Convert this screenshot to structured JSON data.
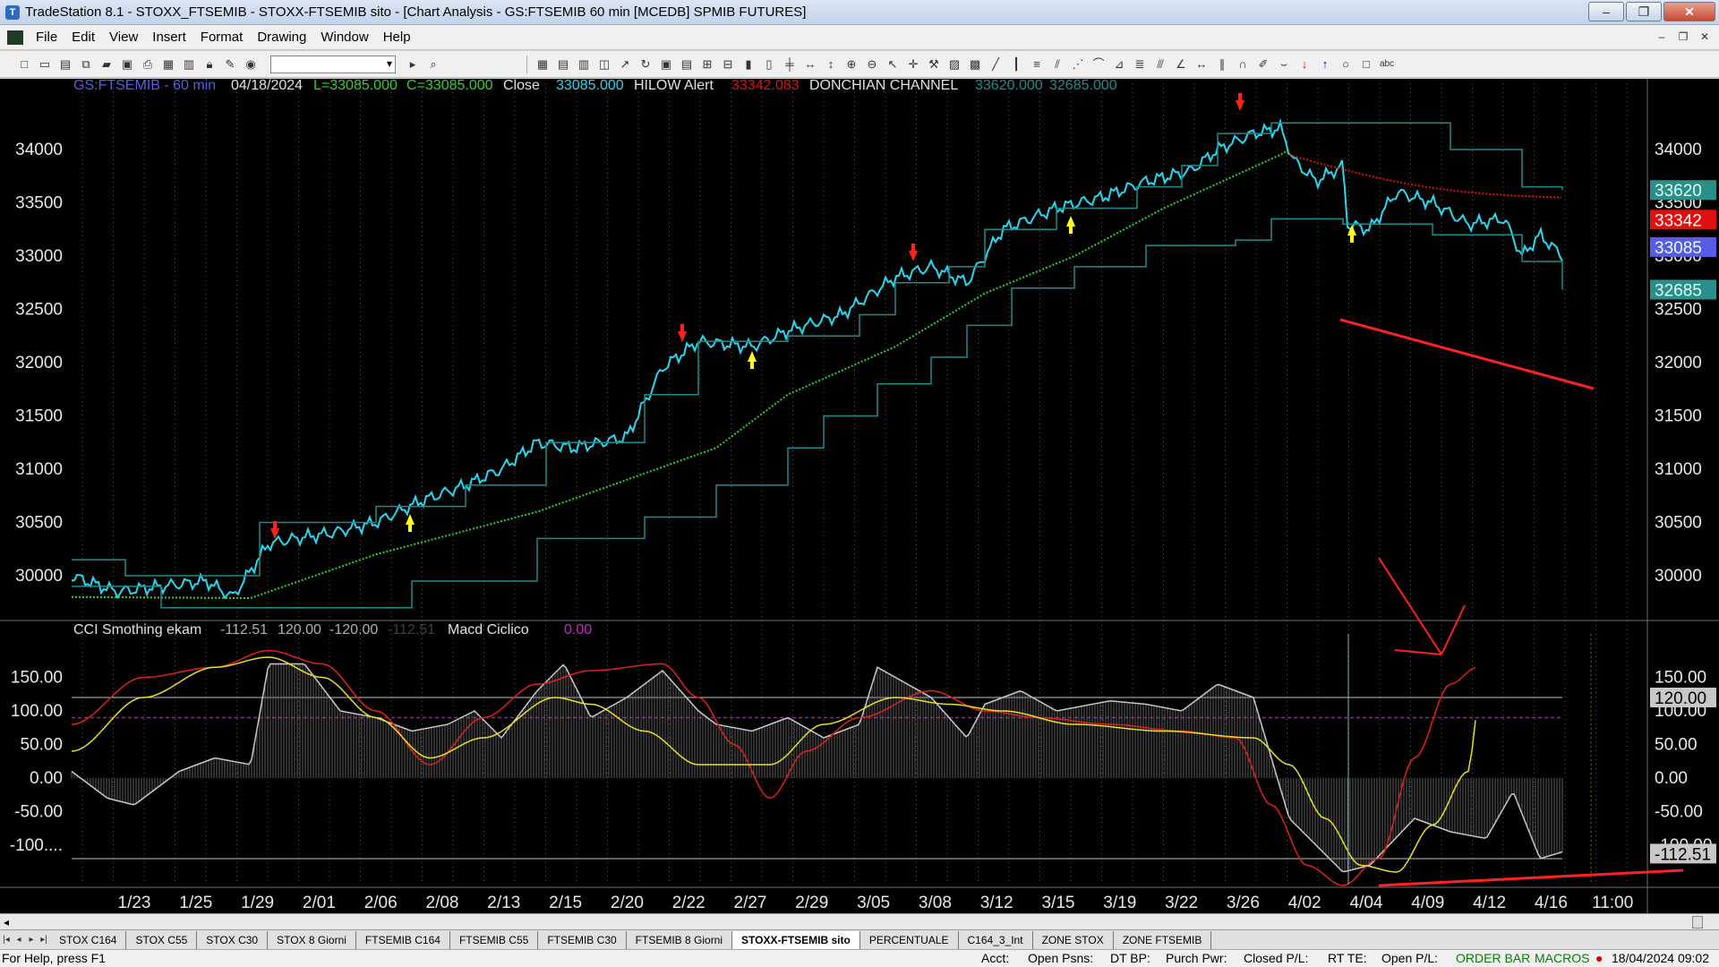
{
  "window": {
    "title": "TradeStation 8.1 - STOXX_FTSEMIB - STOXX-FTSEMIB sito - [Chart Analysis - GS:FTSEMIB  60 min  [MCEDB] SPMIB FUTURES]",
    "minimize_label": "–",
    "maximize_label": "❐",
    "close_label": "✕"
  },
  "menu": [
    "File",
    "Edit",
    "View",
    "Insert",
    "Format",
    "Drawing",
    "Window",
    "Help"
  ],
  "chart": {
    "header": {
      "symbol": "GS:FTSEMIB - 60 min",
      "date": "04/18/2024",
      "low": "L=33085.000",
      "close": "C=33085.000",
      "close_label": "Close",
      "close_value": "33085.000",
      "hilow_label": "HILOW Alert",
      "hilow_value": "33342.083",
      "donchian_label": "DONCHIAN CHANNEL",
      "donchian_upper": "33620.000",
      "donchian_lower": "32685.000"
    },
    "price_axis_left": [
      "34000",
      "33500",
      "33000",
      "32500",
      "32000",
      "31500",
      "31000",
      "30500",
      "30000"
    ],
    "price_axis_right": [
      "34000",
      "33500",
      "33000",
      "32500",
      "32000",
      "31500",
      "31000",
      "30500",
      "30000"
    ],
    "price_badges": [
      {
        "value": "33620",
        "color": "#2a8f8a"
      },
      {
        "value": "33342",
        "color": "#e01010"
      },
      {
        "value": "33085",
        "color": "#5a5ae8"
      },
      {
        "value": "32685",
        "color": "#2a8f8a"
      }
    ],
    "indicator_header": {
      "name": "CCI Smothing ekam",
      "v1": "-112.51",
      "v2": "120.00",
      "v3": "-120.00",
      "v4": "-112.51",
      "macd_label": "Macd Ciclico",
      "macd_value": "0.00"
    },
    "ind_axis_left": [
      "150.00",
      "100.00",
      "50.00",
      "0.00",
      "-50.00",
      "-100...."
    ],
    "ind_axis_right": [
      "150.00",
      "100.00",
      "50.00",
      "0.00",
      "-50.00",
      "-100.00"
    ],
    "ind_badges": [
      {
        "value": "120.00",
        "color": "#c8c8c8"
      },
      {
        "value": "-112.51",
        "color": "#c8c8c8"
      }
    ],
    "date_axis": [
      "1/23",
      "1/25",
      "1/29",
      "2/01",
      "2/06",
      "2/08",
      "2/13",
      "2/15",
      "2/20",
      "2/22",
      "2/27",
      "2/29",
      "3/05",
      "3/08",
      "3/12",
      "3/15",
      "3/19",
      "3/22",
      "3/26",
      "4/02",
      "4/04",
      "4/09",
      "4/12",
      "4/16",
      "11:00"
    ],
    "colors": {
      "price": "#28d8f0",
      "ma": "#2fd02f",
      "donchian": "#1e8c8c",
      "hilow": "#e01010",
      "cci_red": "#e02020",
      "cci_yellow": "#e8e020",
      "histogram": "#9a9a9a"
    }
  },
  "tabs": [
    "STOX C164",
    "STOX C55",
    "STOX  C30",
    "STOX  8 Giorni",
    "FTSEMIB C164",
    "FTSEMIB C55",
    "FTSEMIB C30",
    "FTSEMIB  8 Giorni",
    "STOXX-FTSEMIB sito",
    "PERCENTUALE",
    "C164_3_Int",
    "ZONE STOX",
    "ZONE FTSEMIB"
  ],
  "active_tab": "STOXX-FTSEMIB sito",
  "status": {
    "help": "For Help, press F1",
    "acct": "Acct:",
    "open_psns": "Open Psns:",
    "dt_bp": "DT BP:",
    "purch_pwr": "Purch Pwr:",
    "closed_pl": "Closed P/L:",
    "rt_te": "RT TE:",
    "open_pl": "Open P/L:",
    "order_bar": "ORDER BAR",
    "macros": "MACROS",
    "datetime": "18/04/2024 09:02"
  }
}
